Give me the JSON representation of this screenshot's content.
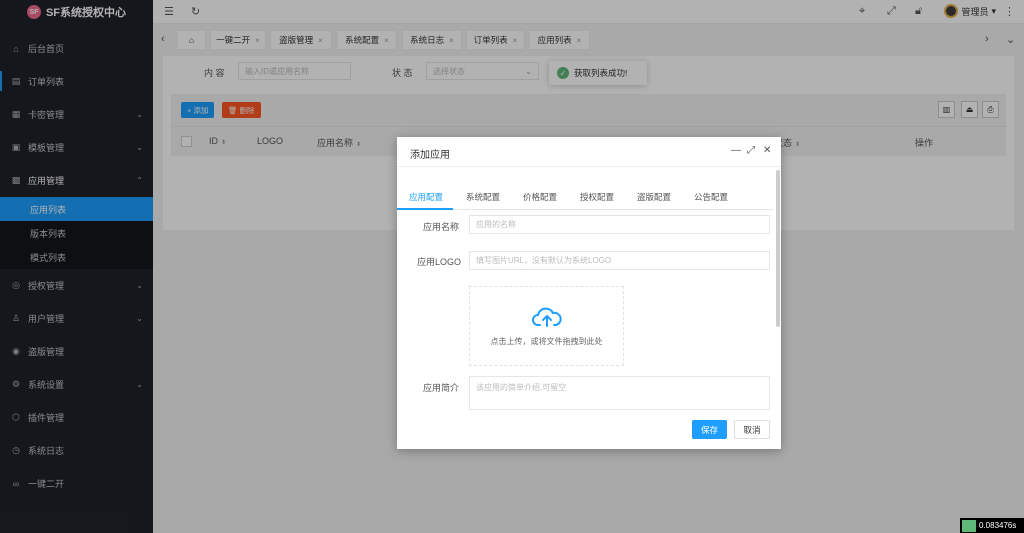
{
  "brand": {
    "logo_text": "SF",
    "title": "SF系统授权中心"
  },
  "sidebar": {
    "items": [
      {
        "key": "home",
        "label": "后台首页",
        "icon": "⌂"
      },
      {
        "key": "orders",
        "label": "订单列表",
        "icon": "▤"
      },
      {
        "key": "cards",
        "label": "卡密管理",
        "icon": "▦",
        "chevron": "⌄"
      },
      {
        "key": "templates",
        "label": "模板管理",
        "icon": "▣",
        "chevron": "⌄"
      },
      {
        "key": "apps",
        "label": "应用管理",
        "icon": "▩",
        "chevron": "⌃"
      }
    ],
    "app_sub": [
      {
        "label": "应用列表"
      },
      {
        "label": "版本列表"
      },
      {
        "label": "模式列表"
      }
    ],
    "items_after": [
      {
        "key": "auth",
        "label": "授权管理",
        "icon": "◎",
        "chevron": "⌄"
      },
      {
        "key": "users",
        "label": "用户管理",
        "icon": "♙",
        "chevron": "⌄"
      },
      {
        "key": "piracy",
        "label": "盗版管理",
        "icon": "◉"
      },
      {
        "key": "settings",
        "label": "系统设置",
        "icon": "⚙",
        "chevron": "⌄"
      },
      {
        "key": "plugins",
        "label": "插件管理",
        "icon": "⬡"
      },
      {
        "key": "logs",
        "label": "系统日志",
        "icon": "◷"
      },
      {
        "key": "dual",
        "label": "一键二开",
        "icon": "∞"
      }
    ]
  },
  "header": {
    "admin_name": "管理员"
  },
  "tabs": [
    {
      "label": "一键二开"
    },
    {
      "label": "盗版管理"
    },
    {
      "label": "系统配置"
    },
    {
      "label": "系统日志"
    },
    {
      "label": "订单列表"
    },
    {
      "label": "应用列表"
    }
  ],
  "filters": {
    "content_label": "内  容",
    "content_placeholder": "输入ID或应用名称",
    "status_label": "状  态",
    "status_placeholder": "选择状态"
  },
  "toolbar": {
    "add_label": "添加",
    "delete_label": "删除"
  },
  "table": {
    "headers": {
      "id": "ID",
      "logo": "LOGO",
      "name": "应用名称",
      "status": "状态",
      "ops": "操作"
    }
  },
  "toast": {
    "message": "获取列表成功!"
  },
  "modal": {
    "title": "添加应用",
    "tabs": [
      "应用配置",
      "系统配置",
      "价格配置",
      "授权配置",
      "盗版配置",
      "公告配置"
    ],
    "fields": {
      "name_label": "应用名称",
      "name_placeholder": "应用的名称",
      "logo_label": "应用LOGO",
      "logo_placeholder": "填写图片URL，没有默认为系统LOGO",
      "upload_text": "点击上传，或将文件拖拽到此处",
      "desc_label": "应用简介",
      "desc_placeholder": "该应用的简单介绍,可留空"
    },
    "save_label": "保存",
    "cancel_label": "取消"
  },
  "debug": {
    "time": "0.083476s"
  },
  "colors": {
    "accent": "#1e9fff",
    "danger": "#ff5722",
    "success": "#5fb878",
    "sidebar": "#20222a"
  }
}
